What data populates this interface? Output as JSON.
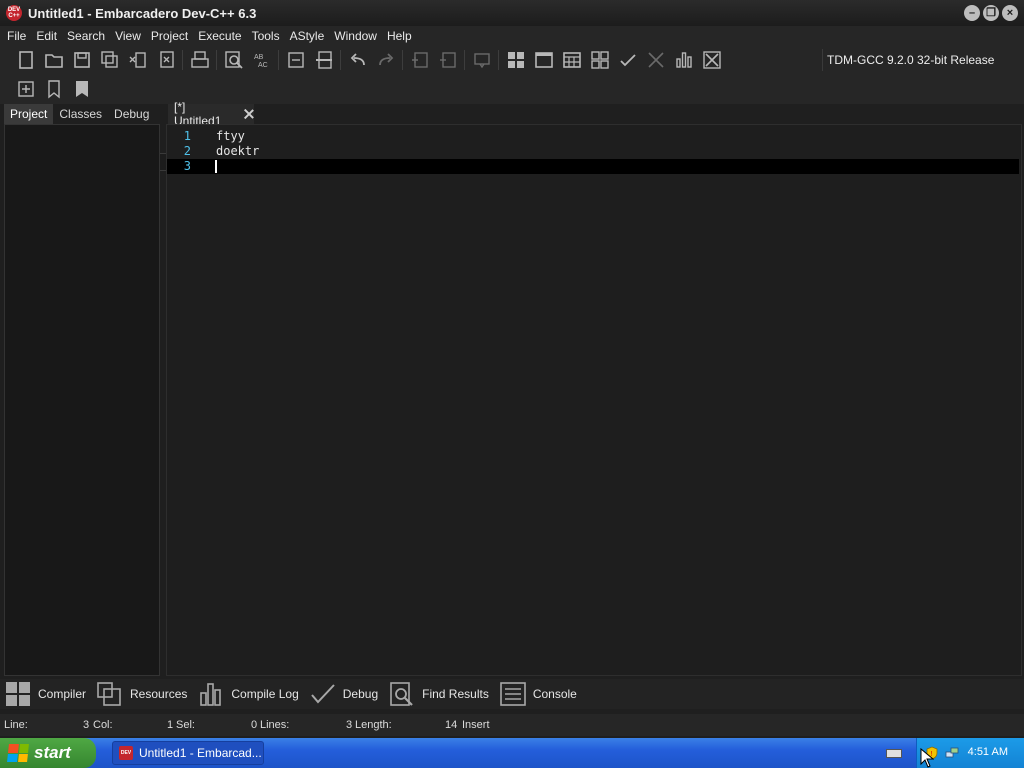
{
  "window": {
    "title": "Untitled1 - Embarcadero Dev-C++ 6.3",
    "logo_text": "DEV\nC++"
  },
  "menu": [
    "File",
    "Edit",
    "Search",
    "View",
    "Project",
    "Execute",
    "Tools",
    "AStyle",
    "Window",
    "Help"
  ],
  "toolbar": {
    "compiler": "TDM-GCC 9.2.0 32-bit Release"
  },
  "left_tabs": [
    "Project",
    "Classes",
    "Debug"
  ],
  "editor": {
    "tab_label": "[*] Untitled1",
    "lines": [
      {
        "number": "1",
        "text": "ftyy"
      },
      {
        "number": "2",
        "text": "doektr"
      },
      {
        "number": "3",
        "text": ""
      }
    ]
  },
  "bottom_tabs": [
    "Compiler",
    "Resources",
    "Compile Log",
    "Debug",
    "Find Results",
    "Console"
  ],
  "status": {
    "line_label": "Line:",
    "line_value": "3",
    "col_label": "Col:",
    "col_value": "1",
    "sel_label": "Sel:",
    "sel_value": "0",
    "lines_label": "Lines:",
    "lines_value": "3",
    "length_label": "Length:",
    "length_value": "14",
    "mode": "Insert"
  },
  "taskbar": {
    "start_label": "start",
    "task_label": "Untitled1 - Embarcad...",
    "clock": "4:51 AM"
  },
  "colors": {
    "accent_logo": "#c4262e",
    "line_numbers": "#4fc1e9",
    "taskbar_blue": "#245edb",
    "start_green": "#35862f"
  }
}
